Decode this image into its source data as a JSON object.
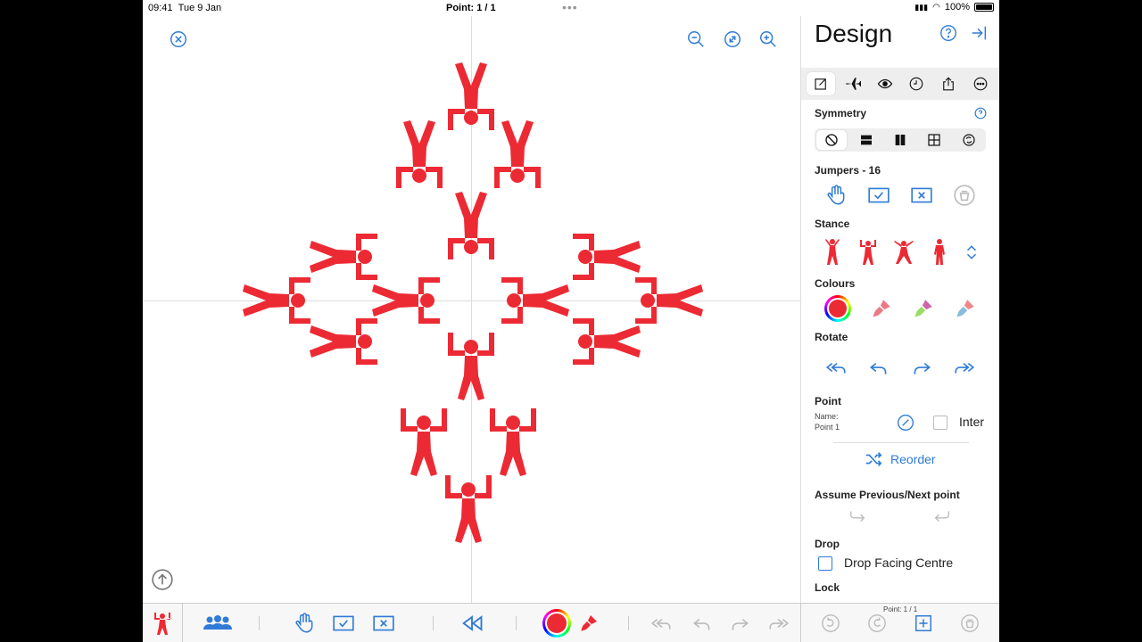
{
  "status": {
    "time": "09:41",
    "date": "Tue 9 Jan",
    "center": "Point: 1 / 1",
    "battery": "100%"
  },
  "panel": {
    "title": "Design",
    "symmetry_label": "Symmetry",
    "jumpers_label": "Jumpers - 16",
    "stance_label": "Stance",
    "colours_label": "Colours",
    "rotate_label": "Rotate",
    "point_label": "Point",
    "name_label": "Name:",
    "name_value": "Point 1",
    "inter_label": "Inter",
    "reorder_label": "Reorder",
    "assume_label": "Assume Previous/Next point",
    "drop_label": "Drop",
    "drop_facing_label": "Drop Facing Centre",
    "lock_label": "Lock",
    "footer_point": "Point: 1 / 1"
  },
  "colors": {
    "accent": "#2f7bd6",
    "jumper": "#ec2a34"
  },
  "icons": [
    "close-icon",
    "zoom-out-icon",
    "fit-icon",
    "zoom-in-icon",
    "help-icon",
    "collapse-icon",
    "edit-icon",
    "airplane-icon",
    "eye-icon",
    "clock-icon",
    "share-icon",
    "more-icon",
    "up-icon"
  ]
}
